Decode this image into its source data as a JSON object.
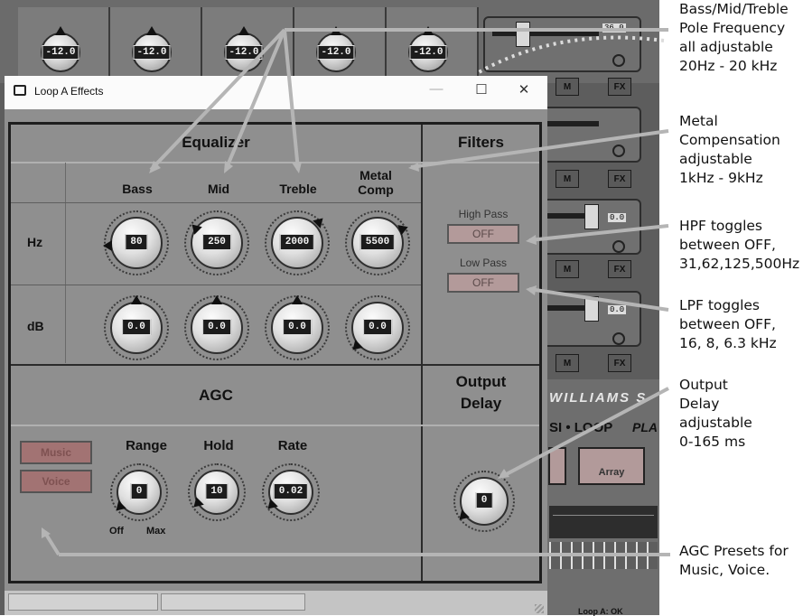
{
  "background": {
    "top_knob_values": [
      "-12.0",
      "-12.0",
      "-12.0",
      "-12.0",
      "-12.0"
    ],
    "right_panel_values": [
      "36.0",
      "0.0",
      "0.0"
    ],
    "mute_labels": [
      "M",
      "M",
      "M",
      "M"
    ],
    "fx_labels": [
      "FX",
      "FX",
      "FX",
      "FX"
    ],
    "brand_text": "WILLIAMS S",
    "loop_text": "SI • LOOP",
    "play_text": "PLA",
    "array_button": "Array",
    "footer_text": "Loop A: OK"
  },
  "window": {
    "title": "Loop A Effects",
    "minimize": "—",
    "maximize": "☐",
    "close": "✕"
  },
  "equalizer": {
    "header": "Equalizer",
    "columns": [
      "Bass",
      "Mid",
      "Treble",
      "Metal Comp"
    ],
    "rows": [
      "Hz",
      "dB"
    ],
    "hz_values": [
      "80",
      "250",
      "2000",
      "5500"
    ],
    "db_values": [
      "0.0",
      "0.0",
      "0.0",
      "0.0"
    ]
  },
  "filters": {
    "header": "Filters",
    "high_pass_label": "High Pass",
    "high_pass_value": "OFF",
    "low_pass_label": "Low Pass",
    "low_pass_value": "OFF"
  },
  "agc": {
    "header": "AGC",
    "presets": [
      "Music",
      "Voice"
    ],
    "knob_labels": [
      "Range",
      "Hold",
      "Rate"
    ],
    "values": [
      "0",
      "10",
      "0.02"
    ],
    "range_min": "Off",
    "range_max": "Max"
  },
  "output_delay": {
    "header_line1": "Output",
    "header_line2": "Delay",
    "value": "0"
  },
  "annotations": {
    "eq_freq": [
      "Bass/Mid/Treble",
      "Pole Frequency",
      "all adjustable",
      "20Hz - 20 kHz"
    ],
    "metal_comp": [
      "Metal",
      "Compensation",
      "adjustable",
      "1kHz - 9kHz"
    ],
    "hpf": [
      "HPF toggles",
      "between OFF,",
      "31,62,125,500Hz"
    ],
    "lpf": [
      "LPF toggles",
      "between OFF,",
      "16, 8, 6.3 kHz"
    ],
    "output_delay": [
      "Output",
      "Delay",
      "adjustable",
      "0-165 ms"
    ],
    "agc_presets": [
      "AGC Presets for",
      "Music, Voice."
    ]
  }
}
